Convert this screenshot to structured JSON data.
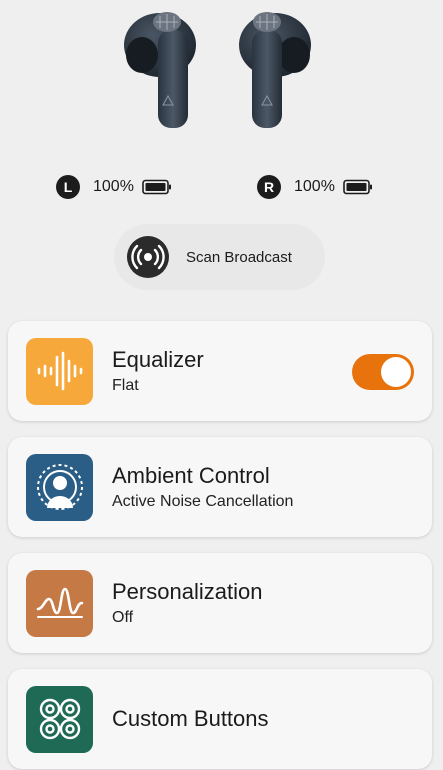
{
  "device": {
    "left": {
      "side": "L",
      "battery": "100%"
    },
    "right": {
      "side": "R",
      "battery": "100%"
    }
  },
  "scan": {
    "label": "Scan Broadcast"
  },
  "cards": [
    {
      "title": "Equalizer",
      "subtitle": "Flat",
      "color": "#f6a93a",
      "icon": "waveform-icon",
      "toggle_on": true
    },
    {
      "title": "Ambient Control",
      "subtitle": "Active Noise Cancellation",
      "color": "#2b5e86",
      "icon": "ambient-person-icon"
    },
    {
      "title": "Personalization",
      "subtitle": "Off",
      "color": "#c57a45",
      "icon": "personalization-wave-icon"
    },
    {
      "title": "Custom Buttons",
      "subtitle": "",
      "color": "#1e6a55",
      "icon": "custom-buttons-icon"
    }
  ],
  "colors": {
    "accent": "#e8720c",
    "background": "#efefef"
  }
}
